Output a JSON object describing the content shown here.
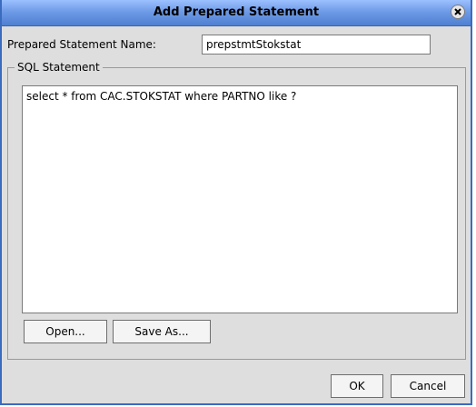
{
  "window": {
    "title": "Add Prepared Statement"
  },
  "form": {
    "name_label": "Prepared Statement Name:",
    "name_value": "prepstmtStokstat"
  },
  "sql": {
    "group_label": "SQL Statement",
    "text": "select * from CAC.STOKSTAT where PARTNO like ?"
  },
  "buttons": {
    "open": "Open...",
    "save_as": "Save As...",
    "ok": "OK",
    "cancel": "Cancel"
  },
  "icons": {
    "close": "close-icon"
  },
  "colors": {
    "title_bar": "#6f9be6",
    "dialog_bg": "#dedede"
  }
}
